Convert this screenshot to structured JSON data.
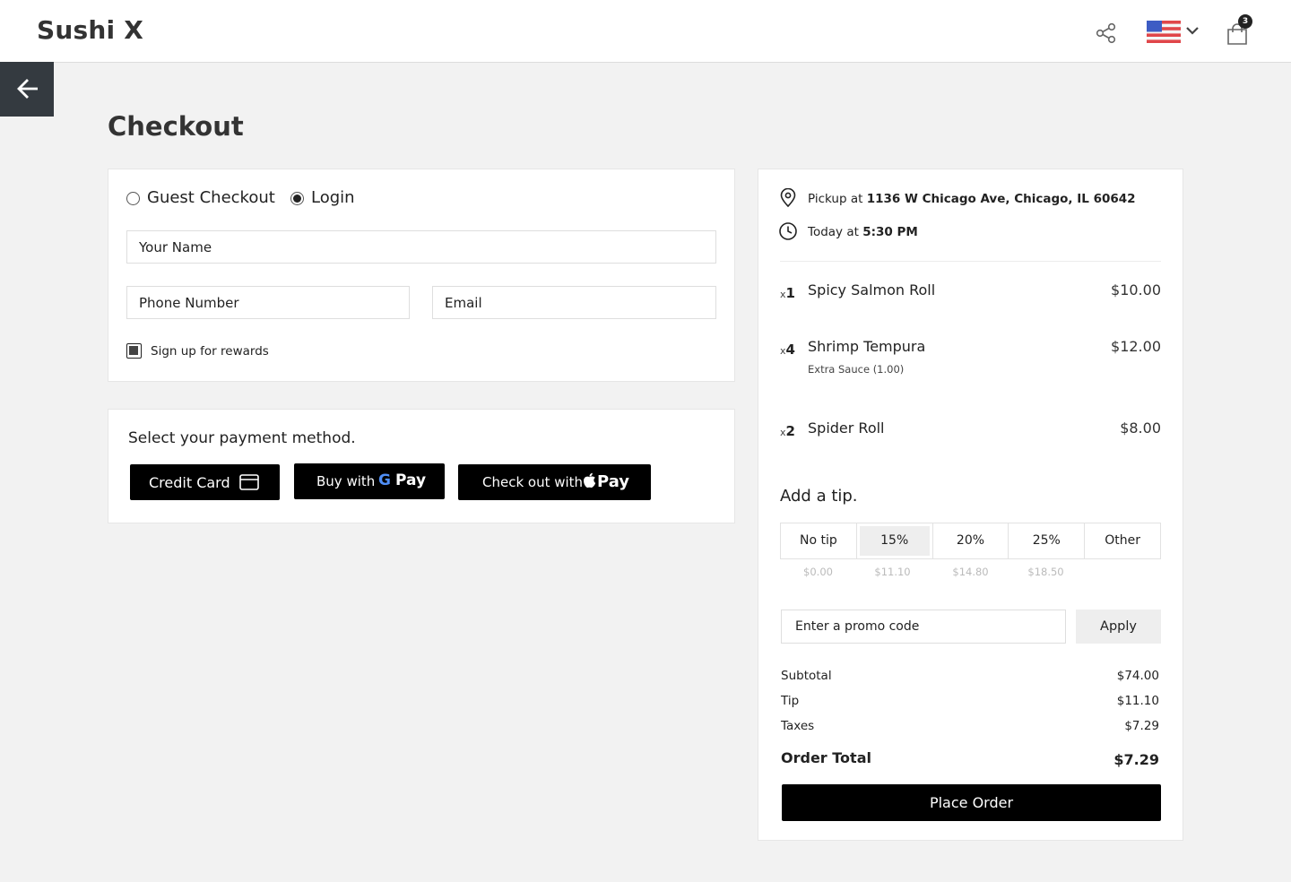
{
  "header": {
    "brand": "Sushi X",
    "cart_count": "3",
    "icons": {
      "share": "share-icon",
      "flag": "us-flag-icon",
      "chevron": "chevron-down-icon",
      "cart": "shopping-bag-icon",
      "back": "arrow-left-icon"
    }
  },
  "page": {
    "title": "Checkout"
  },
  "contact": {
    "option_guest": "Guest Checkout",
    "option_login": "Login",
    "selected": "Login",
    "name_placeholder": "Your Name",
    "phone_placeholder": "Phone Number",
    "email_placeholder": "Email",
    "rewards_label": "Sign up for rewards",
    "rewards_checked": true
  },
  "payment": {
    "heading": "Select your payment method.",
    "credit_card": "Credit Card",
    "gpay_prefix": "Buy with",
    "gpay_g": "G",
    "gpay_word": "Pay",
    "applepay_prefix": "Check out with",
    "applepay_word": "Pay"
  },
  "order": {
    "pickup_prefix": "Pickup at",
    "pickup_address": "1136 W Chicago Ave, Chicago, IL 60642",
    "time_prefix": "Today at",
    "time_value": "5:30 PM",
    "items": [
      {
        "qty_prefix": "x",
        "qty": "1",
        "name": "Spicy Salmon Roll",
        "price": "$10.00",
        "modifier": ""
      },
      {
        "qty_prefix": "x",
        "qty": "4",
        "name": "Shrimp Tempura",
        "price": "$12.00",
        "modifier": "Extra Sauce (1.00)"
      },
      {
        "qty_prefix": "x",
        "qty": "2",
        "name": "Spider Roll",
        "price": "$8.00",
        "modifier": ""
      }
    ]
  },
  "tip": {
    "heading": "Add a tip.",
    "options": [
      {
        "label": "No tip",
        "amount": "$0.00"
      },
      {
        "label": "15%",
        "amount": "$11.10"
      },
      {
        "label": "20%",
        "amount": "$14.80"
      },
      {
        "label": "25%",
        "amount": "$18.50"
      },
      {
        "label": "Other",
        "amount": ""
      }
    ],
    "selected": "15%"
  },
  "promo": {
    "placeholder": "Enter a promo code",
    "apply_label": "Apply"
  },
  "summary": {
    "subtotal_label": "Subtotal",
    "subtotal": "$74.00",
    "tip_label": "Tip",
    "tip": "$11.10",
    "taxes_label": "Taxes",
    "taxes": "$7.29",
    "total_label": "Order Total",
    "total": "$7.29"
  },
  "place_order": "Place Order",
  "colors": {
    "primary_button": "#000000",
    "back_button": "#343a40",
    "page_bg": "#f2f2f2"
  }
}
